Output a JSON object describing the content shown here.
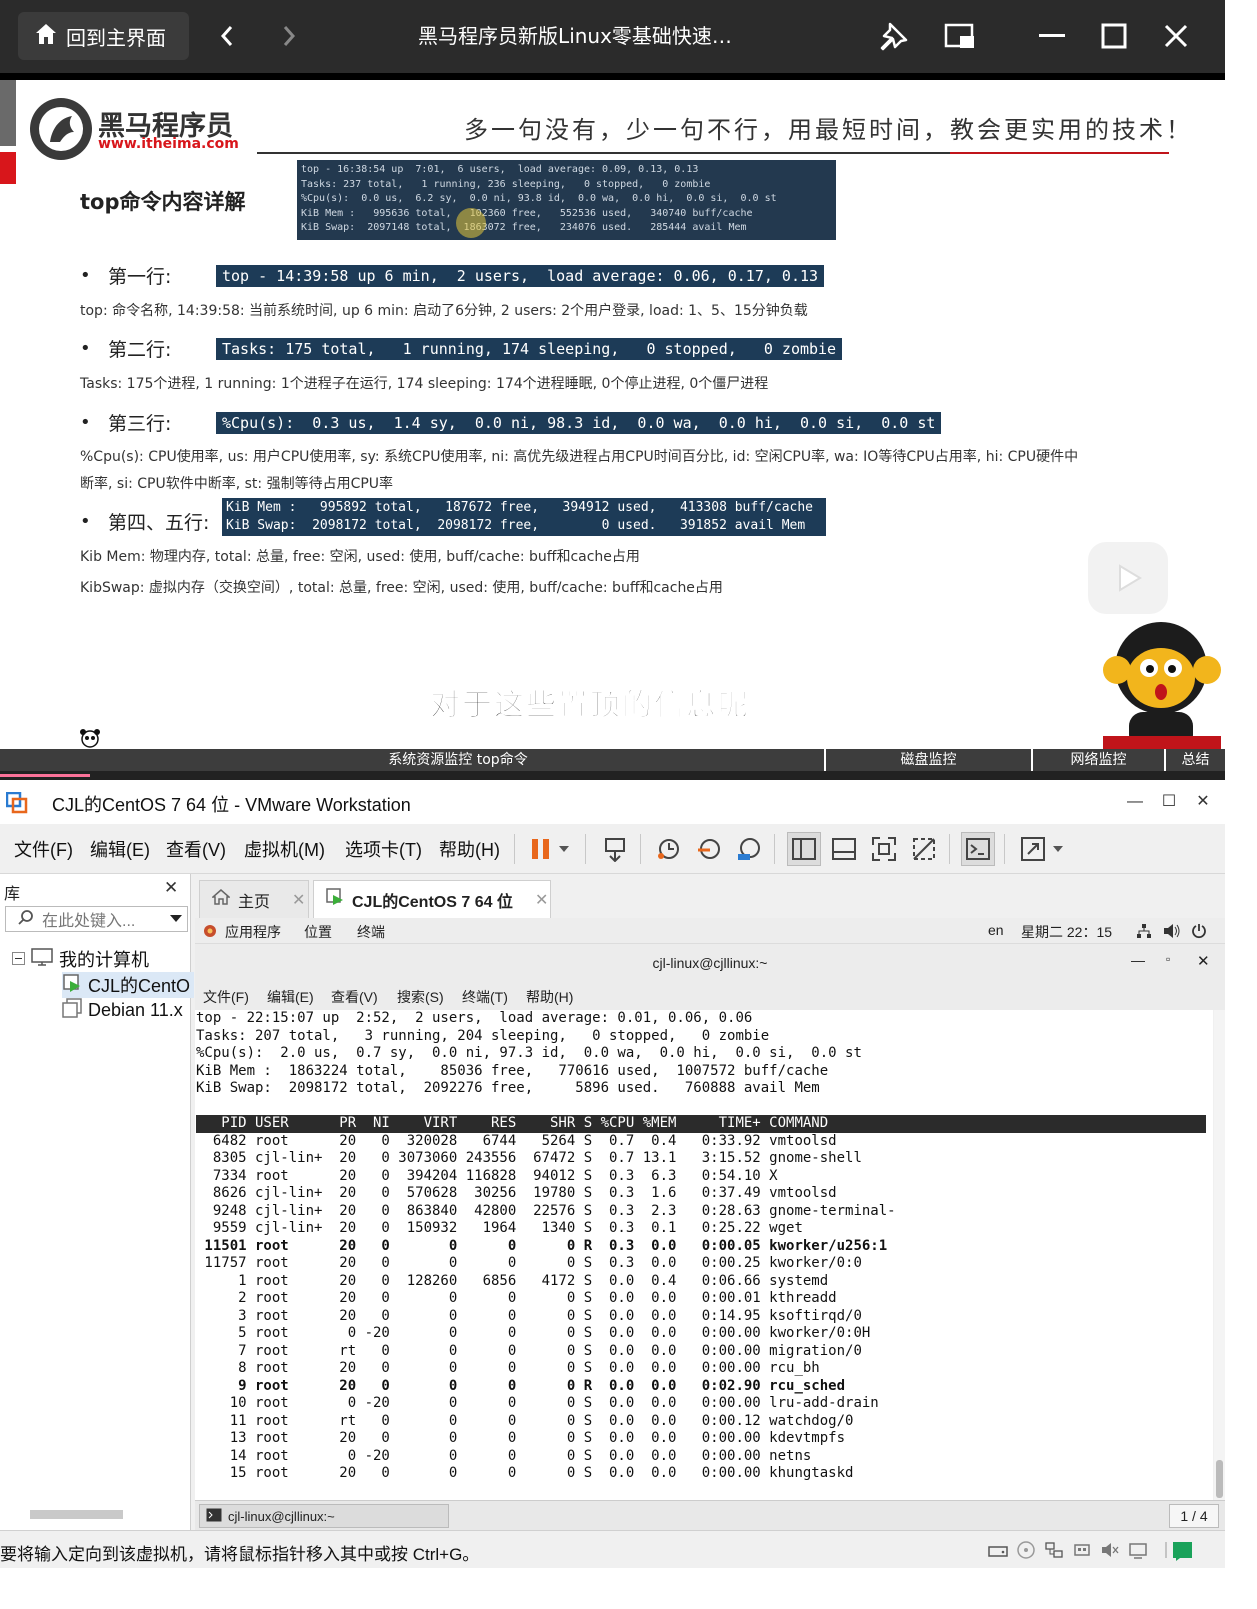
{
  "player": {
    "home_label": "回到主界面",
    "title": "黑马程序员新版Linux零基础快速…"
  },
  "slide": {
    "brand": "黑马程序员",
    "brand_url": "www.itheima.com",
    "slogan": "多一句没有，少一句不行，用最短时间，教会更实用的技术！",
    "heading": "top命令内容详解",
    "screenshot_lines": [
      "top - 16:38:54 up  7:01,  6 users,  load average: 0.09, 0.13, 0.13",
      "Tasks: 237 total,   1 running, 236 sleeping,   0 stopped,   0 zombie",
      "%Cpu(s):  0.0 us,  6.2 sy,  0.0 ni, 93.8 id,  0.0 wa,  0.0 hi,  0.0 si,  0.0 st",
      "KiB Mem :   995636 total,   102360 free,   552536 used,   340740 buff/cache",
      "KiB Swap:  2097148 total,  1863072 free,   234076 used.   285444 avail Mem"
    ],
    "row1_label": "第一行:",
    "row1_box": "top - 14:39:58 up 6 min,  2 users,  load average: 0.06, 0.17, 0.13",
    "row1_desc": "top: 命令名称, 14:39:58: 当前系统时间, up 6 min: 启动了6分钟, 2 users: 2个用户登录, load: 1、5、15分钟负载",
    "row2_label": "第二行:",
    "row2_box": "Tasks: 175 total,   1 running, 174 sleeping,   0 stopped,   0 zombie",
    "row2_desc": "Tasks: 175个进程, 1 running: 1个进程子在运行, 174 sleeping: 174个进程睡眠, 0个停止进程, 0个僵尸进程",
    "row3_label": "第三行:",
    "row3_box": "%Cpu(s):  0.3 us,  1.4 sy,  0.0 ni, 98.3 id,  0.0 wa,  0.0 hi,  0.0 si,  0.0 st",
    "row3_desc_1": "%Cpu(s): CPU使用率, us: 用户CPU使用率, sy: 系统CPU使用率, ni: 高优先级进程占用CPU时间百分比, id: 空闲CPU率, wa: IO等待CPU占用率, hi: CPU硬件中",
    "row3_desc_2": "断率, si: CPU软件中断率, st: 强制等待占用CPU率",
    "row45_label": "第四、五行:",
    "row45_box_1": "KiB Mem :   995892 total,   187672 free,   394912 used,   413308 buff/cache",
    "row45_box_2": "KiB Swap:  2098172 total,  2098172 free,        0 used.   391852 avail Mem",
    "row45_desc_1": "Kib Mem: 物理内存, total: 总量, free: 空闲, used: 使用, buff/cache: buff和cache占用",
    "row45_desc_2": "KibSwap: 虚拟内存（交换空间）, total: 总量, free: 空闲, used: 使用, buff/cache: buff和cache占用",
    "subtitle": "对于这些置顶的信息呢"
  },
  "chapters": [
    "系统资源监控 top命令",
    "磁盘监控",
    "网络监控",
    "总结"
  ],
  "vmware": {
    "title": "CJL的CentOS 7 64 位 - VMware Workstation",
    "menu": [
      "文件(F)",
      "编辑(E)",
      "查看(V)",
      "虚拟机(M)",
      "选项卡(T)",
      "帮助(H)"
    ],
    "library": {
      "title": "库",
      "search_placeholder": "在此处键入...",
      "root": "我的计算机",
      "vms": [
        "CJL的CentO",
        "Debian 11.x"
      ]
    },
    "tabs": [
      "主页",
      "CJL的CentOS 7 64 位"
    ],
    "gnome": {
      "apps": "应用程序",
      "places": "位置",
      "terminal": "终端",
      "lang": "en",
      "clock": "星期二 22：15"
    },
    "terminal": {
      "title": "cjl-linux@cjllinux:~",
      "menu": [
        "文件(F)",
        "编辑(E)",
        "查看(V)",
        "搜索(S)",
        "终端(T)",
        "帮助(H)"
      ],
      "summary": [
        "top - 22:15:07 up  2:52,  2 users,  load average: 0.01, 0.06, 0.06",
        "Tasks: 207 total,   3 running, 204 sleeping,   0 stopped,   0 zombie",
        "%Cpu(s):  2.0 us,  0.7 sy,  0.0 ni, 97.3 id,  0.0 wa,  0.0 hi,  0.0 si,  0.0 st",
        "KiB Mem :  1863224 total,    85036 free,   770616 used,  1007572 buff/cache",
        "KiB Swap:  2098172 total,  2092276 free,     5896 used.   760888 avail Mem"
      ],
      "header": "   PID USER      PR  NI    VIRT    RES    SHR S %CPU %MEM     TIME+ COMMAND",
      "rows": [
        {
          "t": "  6482 root      20   0  320028   6744   5264 S  0.7  0.4   0:33.92 vmtoolsd",
          "bold": false
        },
        {
          "t": "  8305 cjl-lin+  20   0 3073060 243556  67472 S  0.7 13.1   3:15.52 gnome-shell",
          "bold": false
        },
        {
          "t": "  7334 root      20   0  394204 116828  94012 S  0.3  6.3   0:54.10 X",
          "bold": false
        },
        {
          "t": "  8626 cjl-lin+  20   0  570628  30256  19780 S  0.3  1.6   0:37.49 vmtoolsd",
          "bold": false
        },
        {
          "t": "  9248 cjl-lin+  20   0  863840  42800  22576 S  0.3  2.3   0:28.63 gnome-terminal-",
          "bold": false
        },
        {
          "t": "  9559 cjl-lin+  20   0  150932   1964   1340 S  0.3  0.1   0:25.22 wget",
          "bold": false
        },
        {
          "t": " 11501 root      20   0       0      0      0 R  0.3  0.0   0:00.05 kworker/u256:1",
          "bold": true
        },
        {
          "t": " 11757 root      20   0       0      0      0 S  0.3  0.0   0:00.25 kworker/0:0",
          "bold": false
        },
        {
          "t": "     1 root      20   0  128260   6856   4172 S  0.0  0.4   0:06.66 systemd",
          "bold": false
        },
        {
          "t": "     2 root      20   0       0      0      0 S  0.0  0.0   0:00.01 kthreadd",
          "bold": false
        },
        {
          "t": "     3 root      20   0       0      0      0 S  0.0  0.0   0:14.95 ksoftirqd/0",
          "bold": false
        },
        {
          "t": "     5 root       0 -20       0      0      0 S  0.0  0.0   0:00.00 kworker/0:0H",
          "bold": false
        },
        {
          "t": "     7 root      rt   0       0      0      0 S  0.0  0.0   0:00.00 migration/0",
          "bold": false
        },
        {
          "t": "     8 root      20   0       0      0      0 S  0.0  0.0   0:00.00 rcu_bh",
          "bold": false
        },
        {
          "t": "     9 root      20   0       0      0      0 R  0.0  0.0   0:02.90 rcu_sched",
          "bold": true
        },
        {
          "t": "    10 root       0 -20       0      0      0 S  0.0  0.0   0:00.00 lru-add-drain",
          "bold": false
        },
        {
          "t": "    11 root      rt   0       0      0      0 S  0.0  0.0   0:00.12 watchdog/0",
          "bold": false
        },
        {
          "t": "    13 root      20   0       0      0      0 S  0.0  0.0   0:00.00 kdevtmpfs",
          "bold": false
        },
        {
          "t": "    14 root       0 -20       0      0      0 S  0.0  0.0   0:00.00 netns",
          "bold": false
        },
        {
          "t": "    15 root      20   0       0      0      0 S  0.0  0.0   0:00.00 khungtaskd",
          "bold": false
        }
      ],
      "task_label": "cjl-linux@cjllinux:~",
      "page": "1 / 4"
    },
    "status_message": "要将输入定向到该虚拟机，请将鼠标指针移入其中或按 Ctrl+G。",
    "accent": "#e8671c"
  }
}
